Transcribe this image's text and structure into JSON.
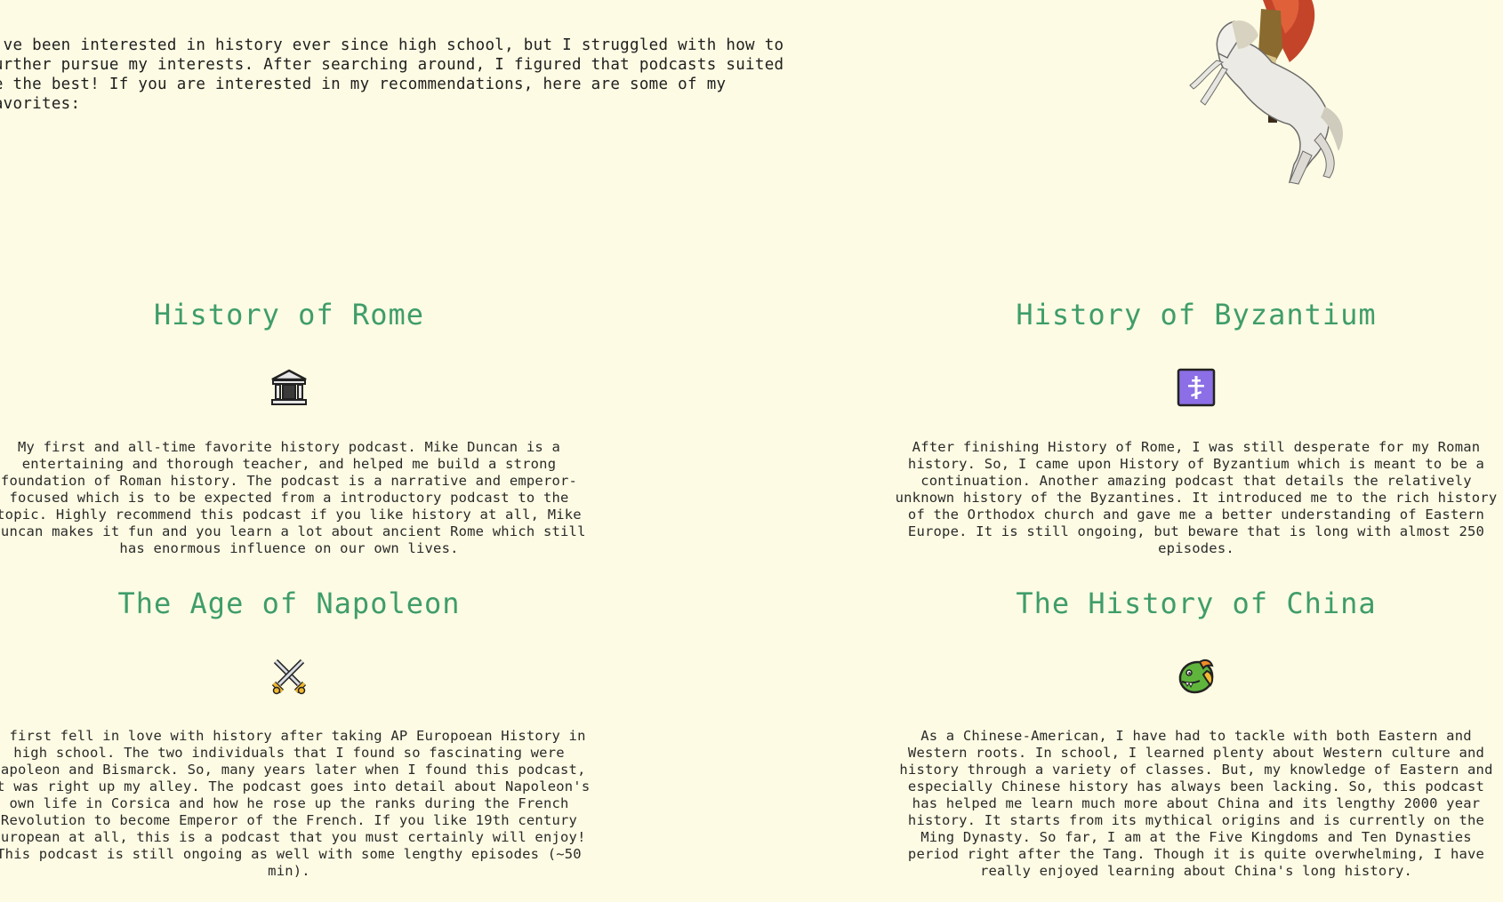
{
  "intro": {
    "text": "I've been interested in history ever since high school, but I struggled with how to further pursue my interests. After searching around, I figured that podcasts suited me the best! If you are interested in my recommendations, here are some of my favorites:"
  },
  "hero_image": {
    "icon": "napoleon-on-horse-illustration"
  },
  "podcasts": [
    {
      "title": "History of Rome",
      "icon": "classical-building-icon",
      "description": "My first and all-time favorite history podcast. Mike Duncan is a entertaining and thorough teacher, and helped me build a strong foundation of Roman history. The podcast is a narrative and emperor-focused which is to be expected from a introductory podcast to the topic. Highly recommend this podcast if you like history at all, Mike Duncan makes it fun and you learn a lot about ancient Rome which still has enormous influence on our own lives."
    },
    {
      "title": "History of Byzantium",
      "icon": "orthodox-cross-icon",
      "description": "After finishing History of Rome, I was still desperate for my Roman history. So, I came upon History of Byzantium which is meant to be a continuation. Another amazing podcast that details the relatively unknown history of the Byzantines. It introduced me to the rich history of the Orthodox church and gave me a better understanding of Eastern Europe. It is still ongoing, but beware that is long with almost 250 episodes."
    },
    {
      "title": "The Age of Napoleon",
      "icon": "crossed-swords-icon",
      "description": "I first fell in love with history after taking AP Europoean History in high school. The two individuals that I found so fascinating were Napoleon and Bismarck. So, many years later when I found this podcast, it was right up my alley. The podcast goes into detail about Napoleon's own life in Corsica and how he rose up the ranks during the French Revolution to become Emperor of the French. If you like 19th century European at all, this is a podcast that you must certainly will enjoy! This podcast is still ongoing as well with some lengthy episodes (~50 min)."
    },
    {
      "title": "The History of China",
      "icon": "dragon-face-icon",
      "description": "As a Chinese-American, I have had to tackle with both Eastern and Western roots. In school, I learned plenty about Western culture and history through a variety of classes. But, my knowledge of Eastern and especially Chinese history has always been lacking. So, this podcast has helped me learn much more about China and its lengthy 2000 year history. It starts from its mythical origins and is currently on the Ming Dynasty. So far, I am at the Five Kingdoms and Ten Dynasties period right after the Tang. Though it is quite overwhelming, I have really enjoyed learning about China's long history."
    }
  ]
}
